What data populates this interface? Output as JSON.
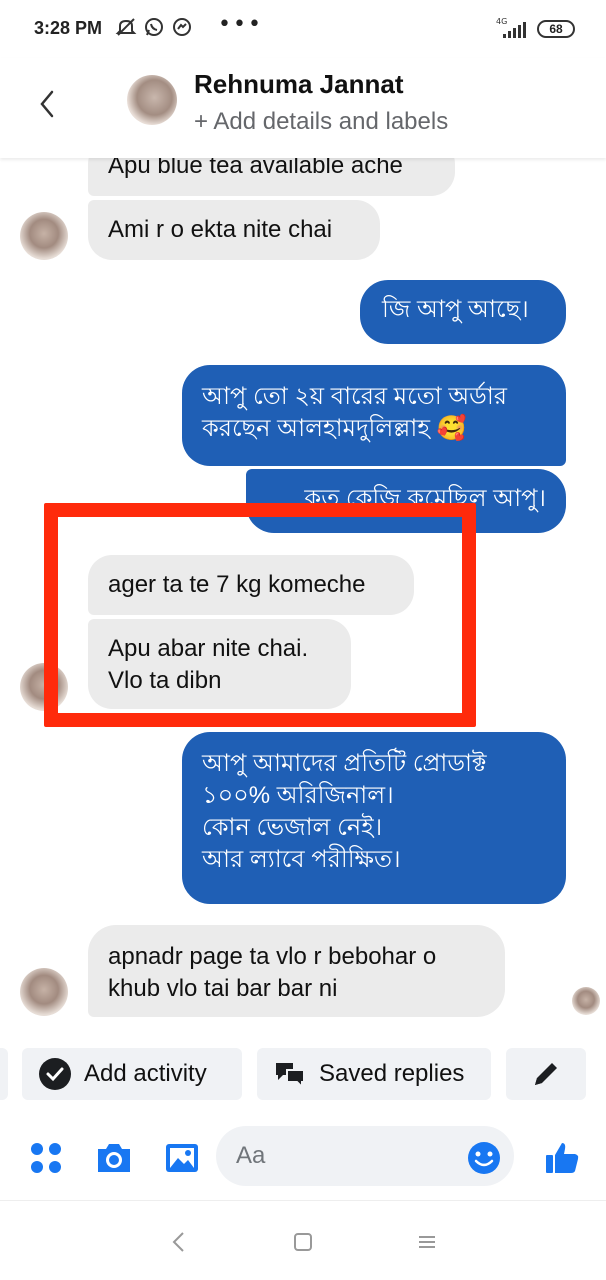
{
  "status_bar": {
    "time": "3:28 PM",
    "network": "4G",
    "battery": "68",
    "icons": [
      "muted-bell-icon",
      "whatsapp-icon",
      "messenger-icon",
      "more-dots-icon",
      "signal-icon",
      "battery-icon"
    ]
  },
  "header": {
    "name": "Rehnuma Jannat",
    "subtitle": "+ Add details and labels",
    "back_icon": "back-arrow-icon"
  },
  "messages": [
    {
      "from": "them",
      "text": "Apu blue tea available ache"
    },
    {
      "from": "them",
      "text": "Ami r o ekta nite chai"
    },
    {
      "from": "me",
      "text": "জি আপু আছে।"
    },
    {
      "from": "me",
      "text_line1": "আপু তো ২য় বারের মতো অর্ডার",
      "text_line2": "করছেন আলহামদুলিল্লাহ 🥰"
    },
    {
      "from": "me",
      "text": "কত কেজি কমেছিল আপু।"
    },
    {
      "from": "them",
      "text": "ager ta te 7 kg komeche"
    },
    {
      "from": "them",
      "text_line1": "Apu abar nite chai.",
      "text_line2": "Vlo ta dibn"
    },
    {
      "from": "me",
      "text_line1": "আপু আমাদের প্রতিটি প্রোডাক্ট",
      "text_line2": "১০০% অরিজিনাল।",
      "text_line3": "কোন ভেজাল নেই।",
      "text_line4": "আর ল্যাবে পরীক্ষিত।"
    },
    {
      "from": "them",
      "text_line1": "apnadr page ta vlo r bebohar o",
      "text_line2": "khub vlo tai bar bar ni"
    }
  ],
  "quick_actions": {
    "add_activity": "Add activity",
    "saved_replies": "Saved replies"
  },
  "composer": {
    "placeholder": "Aa"
  },
  "colors": {
    "outgoing_bubble": "#1f5fb5",
    "incoming_bubble": "#ebebeb",
    "highlight": "#ff2a0b",
    "accent": "#1877f2"
  }
}
